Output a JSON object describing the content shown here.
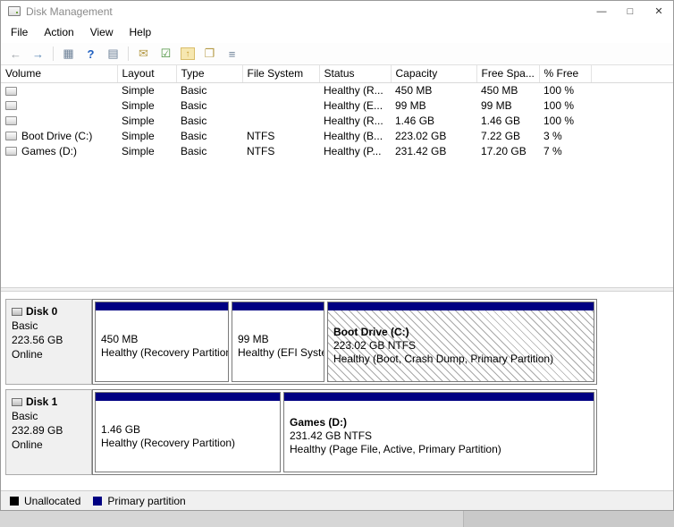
{
  "window": {
    "title": "Disk Management",
    "controls": {
      "minimize": "—",
      "maximize": "□",
      "close": "✕"
    }
  },
  "menu": {
    "items": [
      "File",
      "Action",
      "View",
      "Help"
    ]
  },
  "toolbar": {
    "icons": [
      {
        "name": "back-icon",
        "glyph": "←"
      },
      {
        "name": "forward-icon",
        "glyph": "→"
      },
      {
        "name": "console-tree-icon",
        "glyph": "▦"
      },
      {
        "name": "help-icon",
        "glyph": "?"
      },
      {
        "name": "action-pane-icon",
        "glyph": "▤"
      },
      {
        "name": "callout-icon",
        "glyph": "✉"
      },
      {
        "name": "checkbox-icon",
        "glyph": "☑"
      },
      {
        "name": "folder-up-icon",
        "glyph": "↑"
      },
      {
        "name": "document-icon",
        "glyph": "❐"
      },
      {
        "name": "properties-icon",
        "glyph": "≡"
      }
    ]
  },
  "volume_table": {
    "columns": [
      "Volume",
      "Layout",
      "Type",
      "File System",
      "Status",
      "Capacity",
      "Free Spa...",
      "% Free"
    ],
    "rows": [
      {
        "volume": "",
        "layout": "Simple",
        "type": "Basic",
        "fs": "",
        "status": "Healthy (R...",
        "capacity": "450 MB",
        "free": "450 MB",
        "pct": "100 %"
      },
      {
        "volume": "",
        "layout": "Simple",
        "type": "Basic",
        "fs": "",
        "status": "Healthy (E...",
        "capacity": "99 MB",
        "free": "99 MB",
        "pct": "100 %"
      },
      {
        "volume": "",
        "layout": "Simple",
        "type": "Basic",
        "fs": "",
        "status": "Healthy (R...",
        "capacity": "1.46 GB",
        "free": "1.46 GB",
        "pct": "100 %"
      },
      {
        "volume": "Boot Drive (C:)",
        "layout": "Simple",
        "type": "Basic",
        "fs": "NTFS",
        "status": "Healthy (B...",
        "capacity": "223.02 GB",
        "free": "7.22 GB",
        "pct": "3 %"
      },
      {
        "volume": "Games (D:)",
        "layout": "Simple",
        "type": "Basic",
        "fs": "NTFS",
        "status": "Healthy (P...",
        "capacity": "231.42 GB",
        "free": "17.20 GB",
        "pct": "7 %"
      }
    ]
  },
  "disks": [
    {
      "label": "Disk 0",
      "type": "Basic",
      "size": "223.56 GB",
      "status": "Online",
      "partitions": [
        {
          "title": "",
          "size_line": "450 MB",
          "status_line": "Healthy (Recovery Partition)",
          "selected": false
        },
        {
          "title": "",
          "size_line": "99 MB",
          "status_line": "Healthy (EFI System Partition)",
          "selected": false
        },
        {
          "title": "Boot Drive (C:)",
          "size_line": "223.02 GB NTFS",
          "status_line": "Healthy (Boot, Crash Dump, Primary Partition)",
          "selected": true
        }
      ]
    },
    {
      "label": "Disk 1",
      "type": "Basic",
      "size": "232.89 GB",
      "status": "Online",
      "partitions": [
        {
          "title": "",
          "size_line": "1.46 GB",
          "status_line": "Healthy (Recovery Partition)",
          "selected": false
        },
        {
          "title": "Games (D:)",
          "size_line": "231.42 GB NTFS",
          "status_line": "Healthy (Page File, Active, Primary Partition)",
          "selected": false
        }
      ]
    }
  ],
  "legend": {
    "items": [
      {
        "label": "Unallocated",
        "color": "#000000"
      },
      {
        "label": "Primary partition",
        "color": "#000082"
      }
    ]
  }
}
